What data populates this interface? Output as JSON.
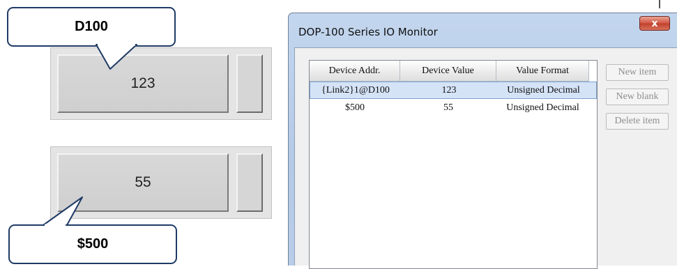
{
  "widgets": [
    {
      "value": "123"
    },
    {
      "value": "55"
    }
  ],
  "callouts": [
    {
      "label": "D100"
    },
    {
      "label": "$500"
    }
  ],
  "dialog": {
    "title": "DOP-100 Series IO Monitor",
    "close_glyph": "x",
    "columns": [
      "Device Addr.",
      "Device Value",
      "Value Format"
    ],
    "rows": [
      {
        "address": "{Link2}1@D100",
        "value": "123",
        "format": "Unsigned Decimal",
        "selected": true
      },
      {
        "address": "$500",
        "value": "55",
        "format": "Unsigned Decimal",
        "selected": false
      }
    ],
    "buttons": {
      "new_item": "New item",
      "new_blank": "New blank",
      "delete_item": "Delete item"
    }
  },
  "colors": {
    "callout_border": "#1f3b66",
    "selection": "#d5e3f7",
    "close_button": "#c0402c",
    "window_frame": "#b3c9e6"
  },
  "icons": {
    "close": "close-icon"
  }
}
